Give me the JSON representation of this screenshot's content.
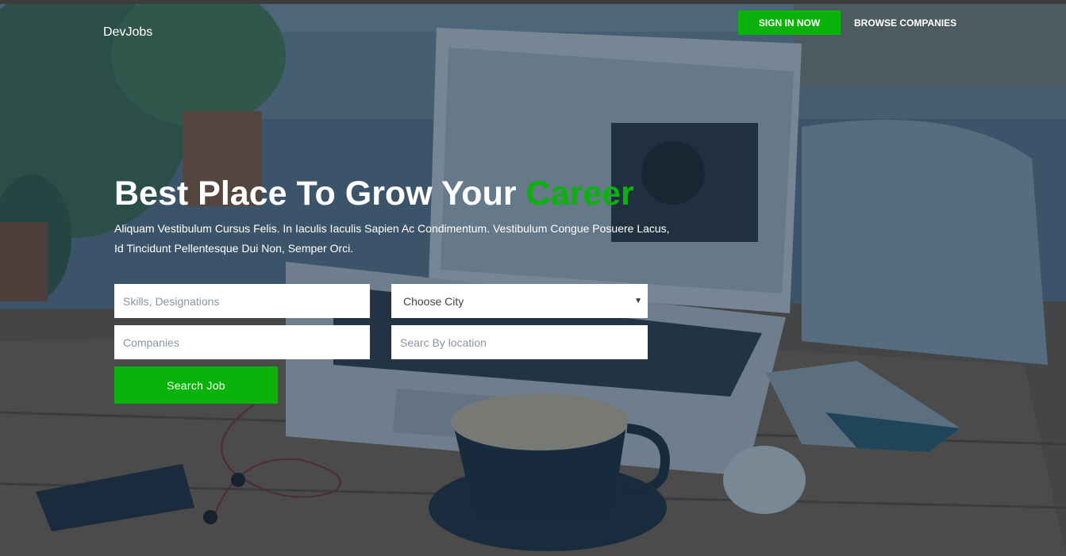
{
  "header": {
    "brand": "DevJobs",
    "signin_label": "SIGN IN NOW",
    "browse_label": "BROWSE COMPANIES"
  },
  "hero": {
    "title_main": "Best Place To Grow Your ",
    "title_accent": "Career",
    "subtitle": "Aliquam Vestibulum Cursus Felis. In Iaculis Iaculis Sapien Ac Condimentum. Vestibulum Congue Posuere Lacus, Id Tincidunt Pellentesque Dui Non, Semper Orci."
  },
  "search": {
    "skills_placeholder": "Skills, Designations",
    "city_selected": "Choose City",
    "companies_placeholder": "Companies",
    "location_placeholder": "Searc By location",
    "button_label": "Search Job"
  },
  "colors": {
    "accent": "#0ab20a",
    "overlay": "#142d46"
  }
}
